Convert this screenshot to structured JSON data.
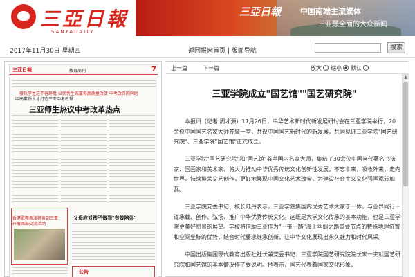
{
  "header": {
    "logo_text": "三亞日報",
    "logo_sub": "SANYADAILY",
    "banner_logo": "三亞日報",
    "banner_title": "中国南端主流媒体",
    "banner_sub": "三亚最全面的大众新闻"
  },
  "infobar": {
    "date": "2017年11月30日 星期四",
    "nav_home": "返回报网首页",
    "nav_sep": " | ",
    "nav_layout": "版面导航",
    "search_placeholder": "",
    "search_button": "搜索"
  },
  "thumbnail": {
    "logo": "三亚日報",
    "section": "教育周刊",
    "page": "7",
    "kicker": "接轨学生这不容辞批  以优秀生态赢得高质量改变  中考改名的同时",
    "subhead": "中高素质人才打造三亚中考改革",
    "headline": "三亚师生热议中考改革热点",
    "photo_caption": "香港歌舞表演将亲到三亚开展西部交流活动",
    "mid_headline": "父母应对孩子做到\"有效陪伴\"",
    "notice": "公告"
  },
  "toolbar": {
    "prev": "上一篇",
    "next": "下一篇",
    "zoom_label": "放大",
    "zoom_mid": "缩小",
    "zoom_default": "默认"
  },
  "article": {
    "title": "三亚学院成立\"国艺馆\"\"国艺研究院\"",
    "p1": "本报讯（记者 周才源）11月26日，中华艺术新时代新发展研讨会在三亚学院举行，20余位中国国艺名家大师齐聚一堂，共议中国国艺新时代的新发展，共同见证三亚学院\"国艺研究院\"、三亚学院\"国艺馆\"正式成立。",
    "p2": "三亚学院\"国艺研究院\"和\"国艺馆\"荟萃国内名家大师，集结了30余位中国当代著名书法家、国画家和美术家，将大力推动中华优秀传统文化创新性发展，不忘本来，吸收外来，走向世界，持续繁荣文艺创作，更好地展现中国文化艺术瑰宝，为建设社会主义文化强国添砖加瓦。",
    "p3": "三亚学院党委书记、校长陆丹表示，三亚学院集国内优秀艺术大家于一体，与业界同行一道承载、创作、弘扬、推广中华优秀传统文化。这既是大学文化传承的基本功能，也是三亚学院更美好愿景的展望。学校将借助三亚作为\"一带一路\"海上丝绸之路重要节点的特殊地理位置和空间坐标的优势，结合时代要求继承创新，让中华文化展现出永久魅力和时代风采。",
    "p4": "中国出版集团现代教育出版社社长兼党委书记、三亚学院国艺研究院院长宋一夫就国艺研究院和国艺馆的基本情况作了要说明。他表示，国艺代表着国家文化形象，"
  }
}
